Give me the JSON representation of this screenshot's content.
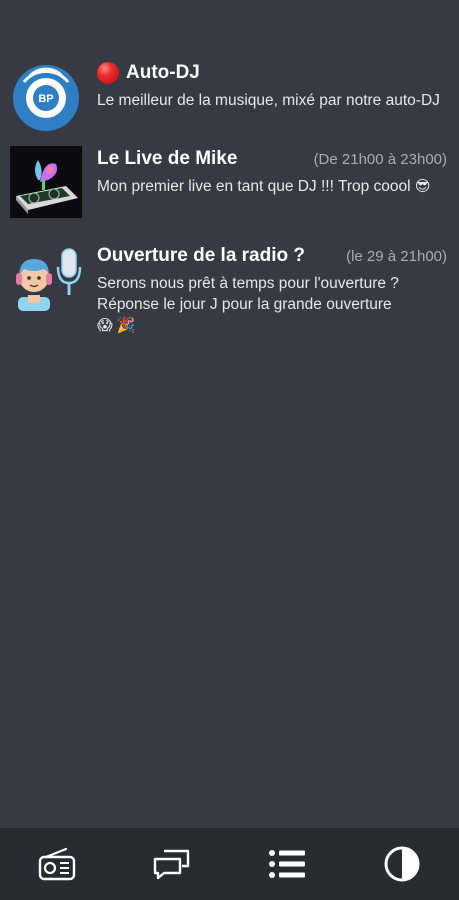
{
  "shows": [
    {
      "title": "Auto-DJ",
      "time": "",
      "live": true,
      "description": "Le meilleur de la musique, mixé par notre auto-DJ",
      "emoji": "",
      "logo_text": "BP"
    },
    {
      "title": "Le Live de Mike",
      "time": "(De 21h00 à 23h00)",
      "live": false,
      "description": "Mon premier live en tant que DJ !!! Trop coool",
      "emoji": "😎"
    },
    {
      "title": "Ouverture de la radio ?",
      "time": "(le 29 à 21h00)",
      "live": false,
      "description": "Serons nous prêt à temps pour l'ouverture ? Réponse le jour J pour la grande ouverture",
      "emoji": "😱 🎉"
    }
  ],
  "nav": [
    {
      "icon": "radio-icon"
    },
    {
      "icon": "chat-icon"
    },
    {
      "icon": "list-icon"
    },
    {
      "icon": "contrast-icon"
    }
  ],
  "colors": {
    "background": "#373a43",
    "bottom_bar": "#2a2b30",
    "accent_blue": "#2e7fc4",
    "text_secondary": "#a9acb4"
  }
}
